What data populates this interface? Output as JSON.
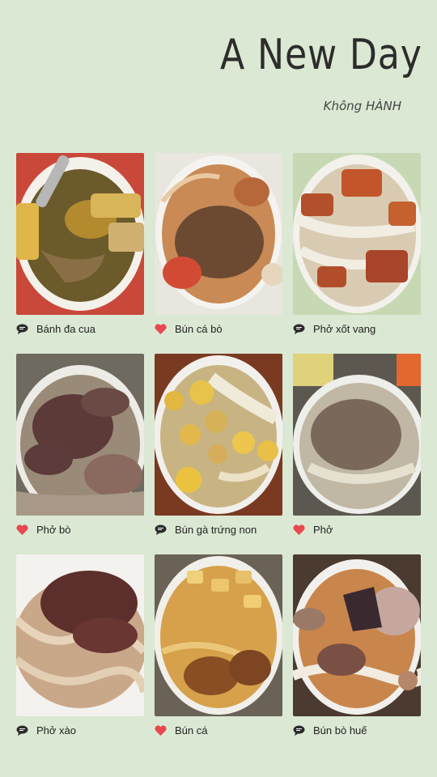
{
  "header": {
    "title": "A New Day",
    "subtitle": "Không HÀNH"
  },
  "dishes": [
    {
      "label": "Bánh đa cua",
      "icon": "comment-icon"
    },
    {
      "label": "Bún cá bò",
      "icon": "heart-icon"
    },
    {
      "label": "Phở xốt vang",
      "icon": "comment-icon"
    },
    {
      "label": "Phở bò",
      "icon": "heart-icon"
    },
    {
      "label": "Bún gà trứng non",
      "icon": "comment-icon"
    },
    {
      "label": "Phở",
      "icon": "heart-icon"
    },
    {
      "label": "Phở xào",
      "icon": "comment-icon"
    },
    {
      "label": "Bún cá",
      "icon": "heart-icon"
    },
    {
      "label": "Bún bò huế",
      "icon": "comment-icon"
    }
  ],
  "colors": {
    "background": "#dbe8d3",
    "heart": "#e8484f",
    "comment": "#2b2b2b"
  }
}
